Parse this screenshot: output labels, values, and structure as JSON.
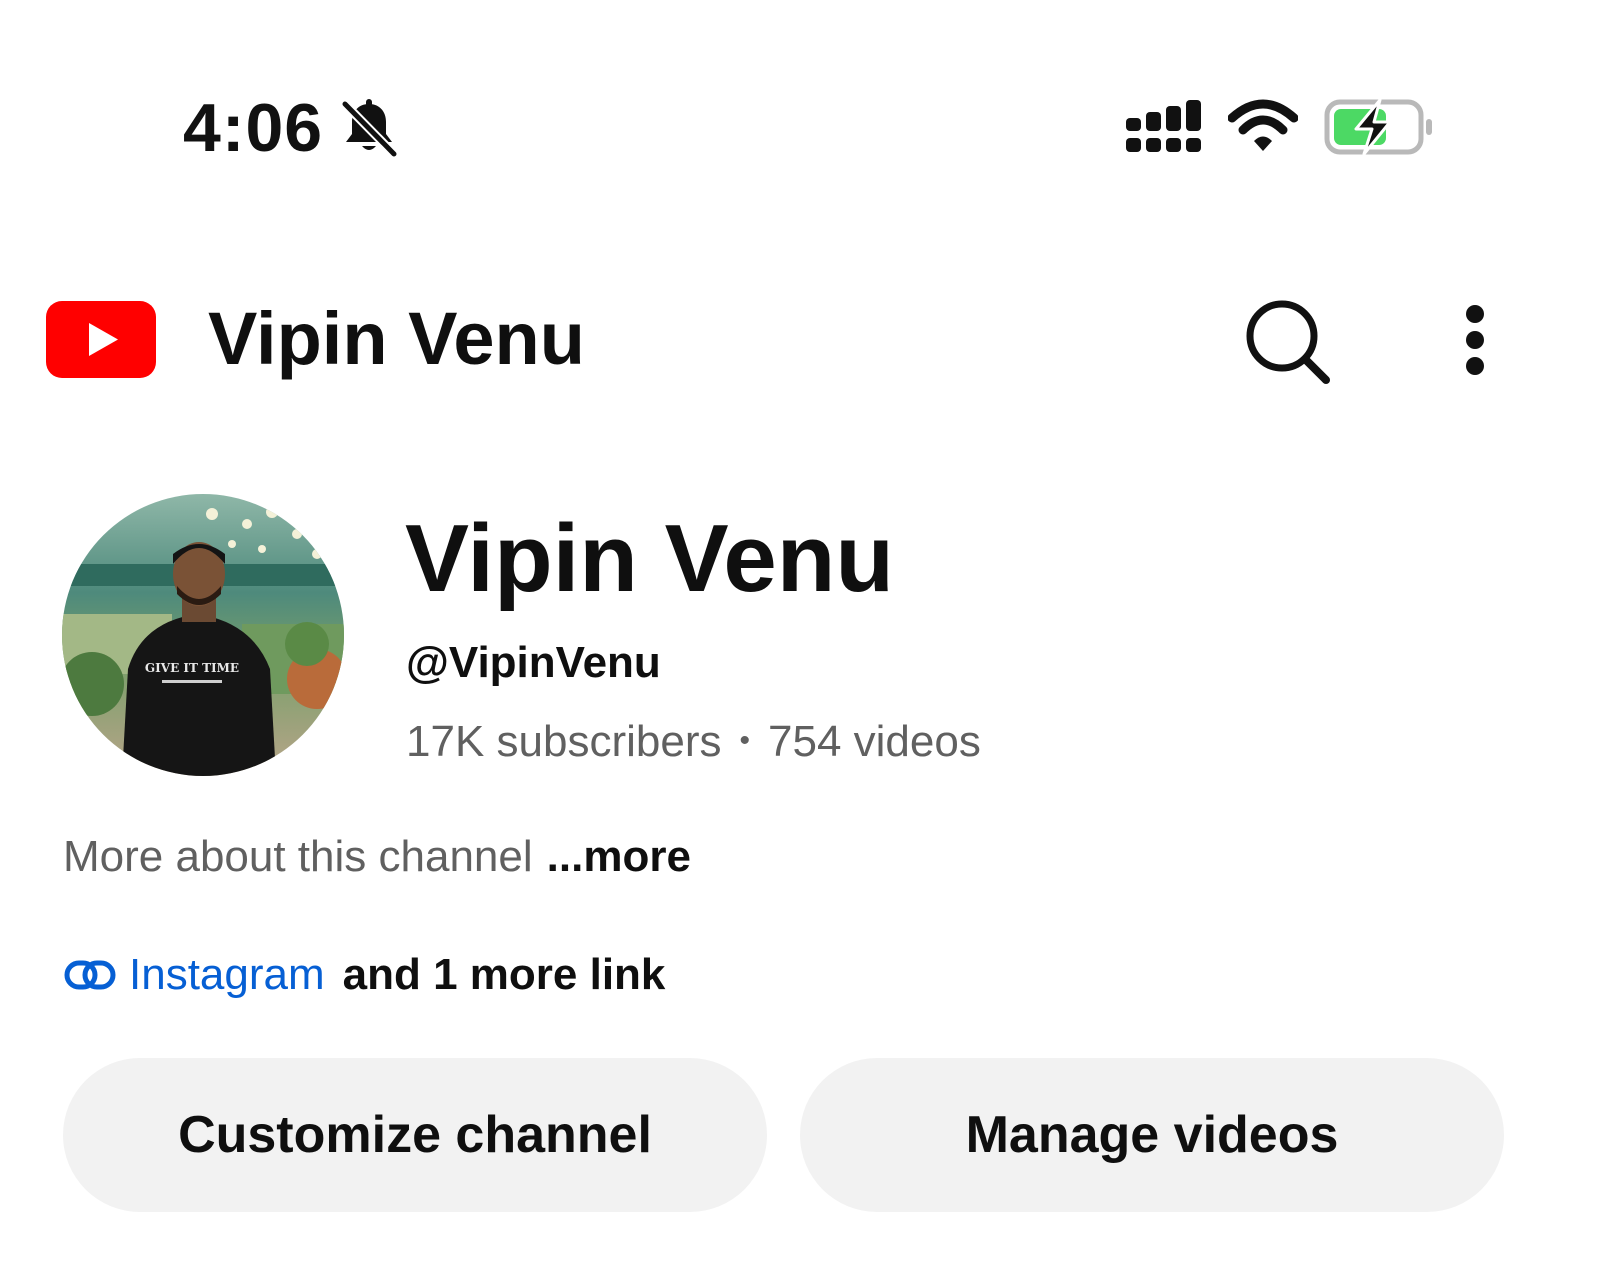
{
  "status_bar": {
    "time": "4:06",
    "icons": [
      "bell-off-icon",
      "signal-icon",
      "wifi-icon",
      "battery-charging-icon"
    ],
    "battery_color": "#4cd964"
  },
  "header": {
    "logo_icon": "youtube-logo-icon",
    "title": "Vipin Venu",
    "actions": [
      "search-icon",
      "more-vertical-icon"
    ],
    "brand_color": "#ff0000"
  },
  "channel": {
    "name": "Vipin Venu",
    "handle": "@VipinVenu",
    "subscribers": "17K subscribers",
    "separator": "•",
    "videos": "754 videos",
    "about_text": "More about this channel",
    "about_more": "...more",
    "link_label": "Instagram",
    "link_extra": "and 1 more link",
    "link_color": "#065fd4",
    "avatar_shirt_text": "GIVE IT TIME"
  },
  "buttons": {
    "customize": "Customize channel",
    "manage": "Manage videos"
  }
}
